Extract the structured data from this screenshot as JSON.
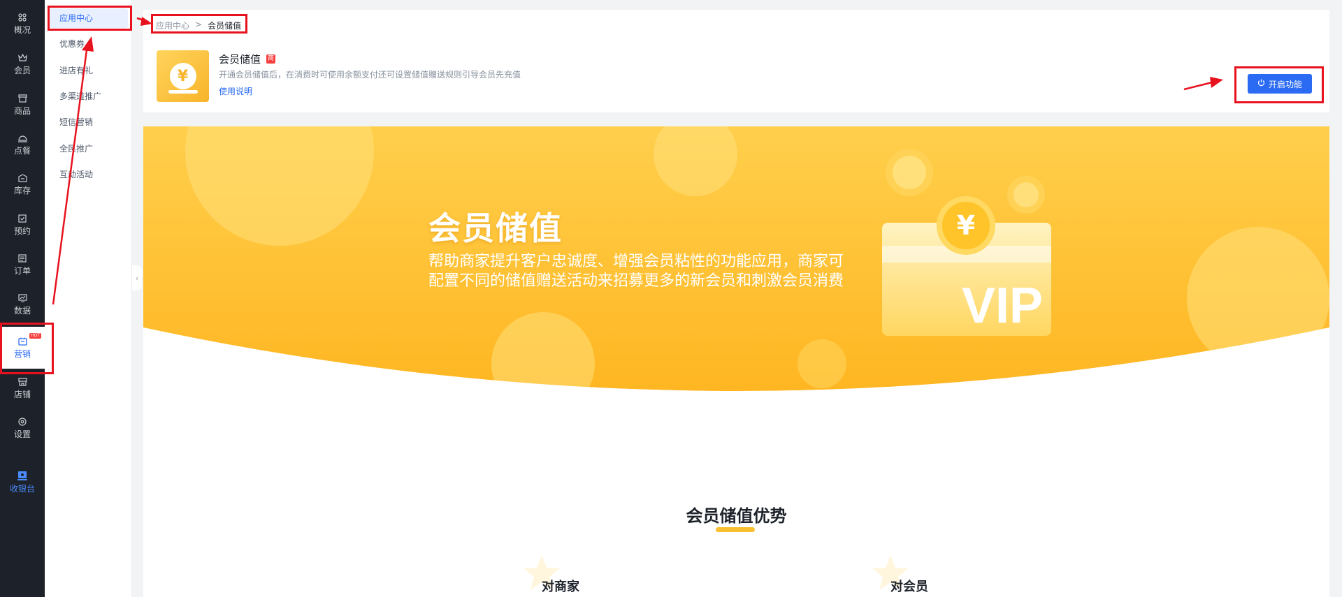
{
  "primary_nav": [
    {
      "label": "概况",
      "icon": "grid-icon"
    },
    {
      "label": "会员",
      "icon": "crown-icon"
    },
    {
      "label": "商品",
      "icon": "store-box-icon"
    },
    {
      "label": "点餐",
      "icon": "dining-icon"
    },
    {
      "label": "库存",
      "icon": "inventory-icon"
    },
    {
      "label": "预约",
      "icon": "calendar-check-icon"
    },
    {
      "label": "订单",
      "icon": "order-list-icon"
    },
    {
      "label": "数据",
      "icon": "data-chart-icon"
    },
    {
      "label": "营销",
      "icon": "marketing-icon",
      "badge": "HOT",
      "active": true
    },
    {
      "label": "店铺",
      "icon": "shop-icon"
    },
    {
      "label": "设置",
      "icon": "settings-icon"
    },
    {
      "label": "收银台",
      "icon": "cashier-icon"
    }
  ],
  "secondary_nav": [
    {
      "label": "应用中心",
      "active": true
    },
    {
      "label": "优惠券"
    },
    {
      "label": "进店有礼"
    },
    {
      "label": "多渠道推广"
    },
    {
      "label": "短信营销"
    },
    {
      "label": "全民推广"
    },
    {
      "label": "互动活动"
    }
  ],
  "breadcrumb": {
    "root": "应用中心",
    "separator": ">",
    "current": "会员储值"
  },
  "app": {
    "title": "会员储值",
    "tag": "商",
    "description": "开通会员储值后，在消费时可使用余额支付还可设置储值赠送规则引导会员先充值",
    "usage_link": "使用说明",
    "enable_button": "开启功能",
    "coin_symbol": "¥"
  },
  "banner": {
    "title": "会员储值",
    "description_line1": "帮助商家提升客户忠诚度、增强会员粘性的功能应用，商家可",
    "description_line2": "配置不同的储值赠送活动来招募更多的新会员和刺激会员消费",
    "vip_text": "VIP",
    "coin_symbol": "¥"
  },
  "advantages": {
    "title": "会员储值优势",
    "for_merchant": "对商家",
    "for_member": "对会员"
  },
  "colors": {
    "sidebar_bg": "#1d2129",
    "accent_blue": "#2b6bf3",
    "banner_yellow": "#ffc63a",
    "annotation_red": "#e8121e"
  }
}
